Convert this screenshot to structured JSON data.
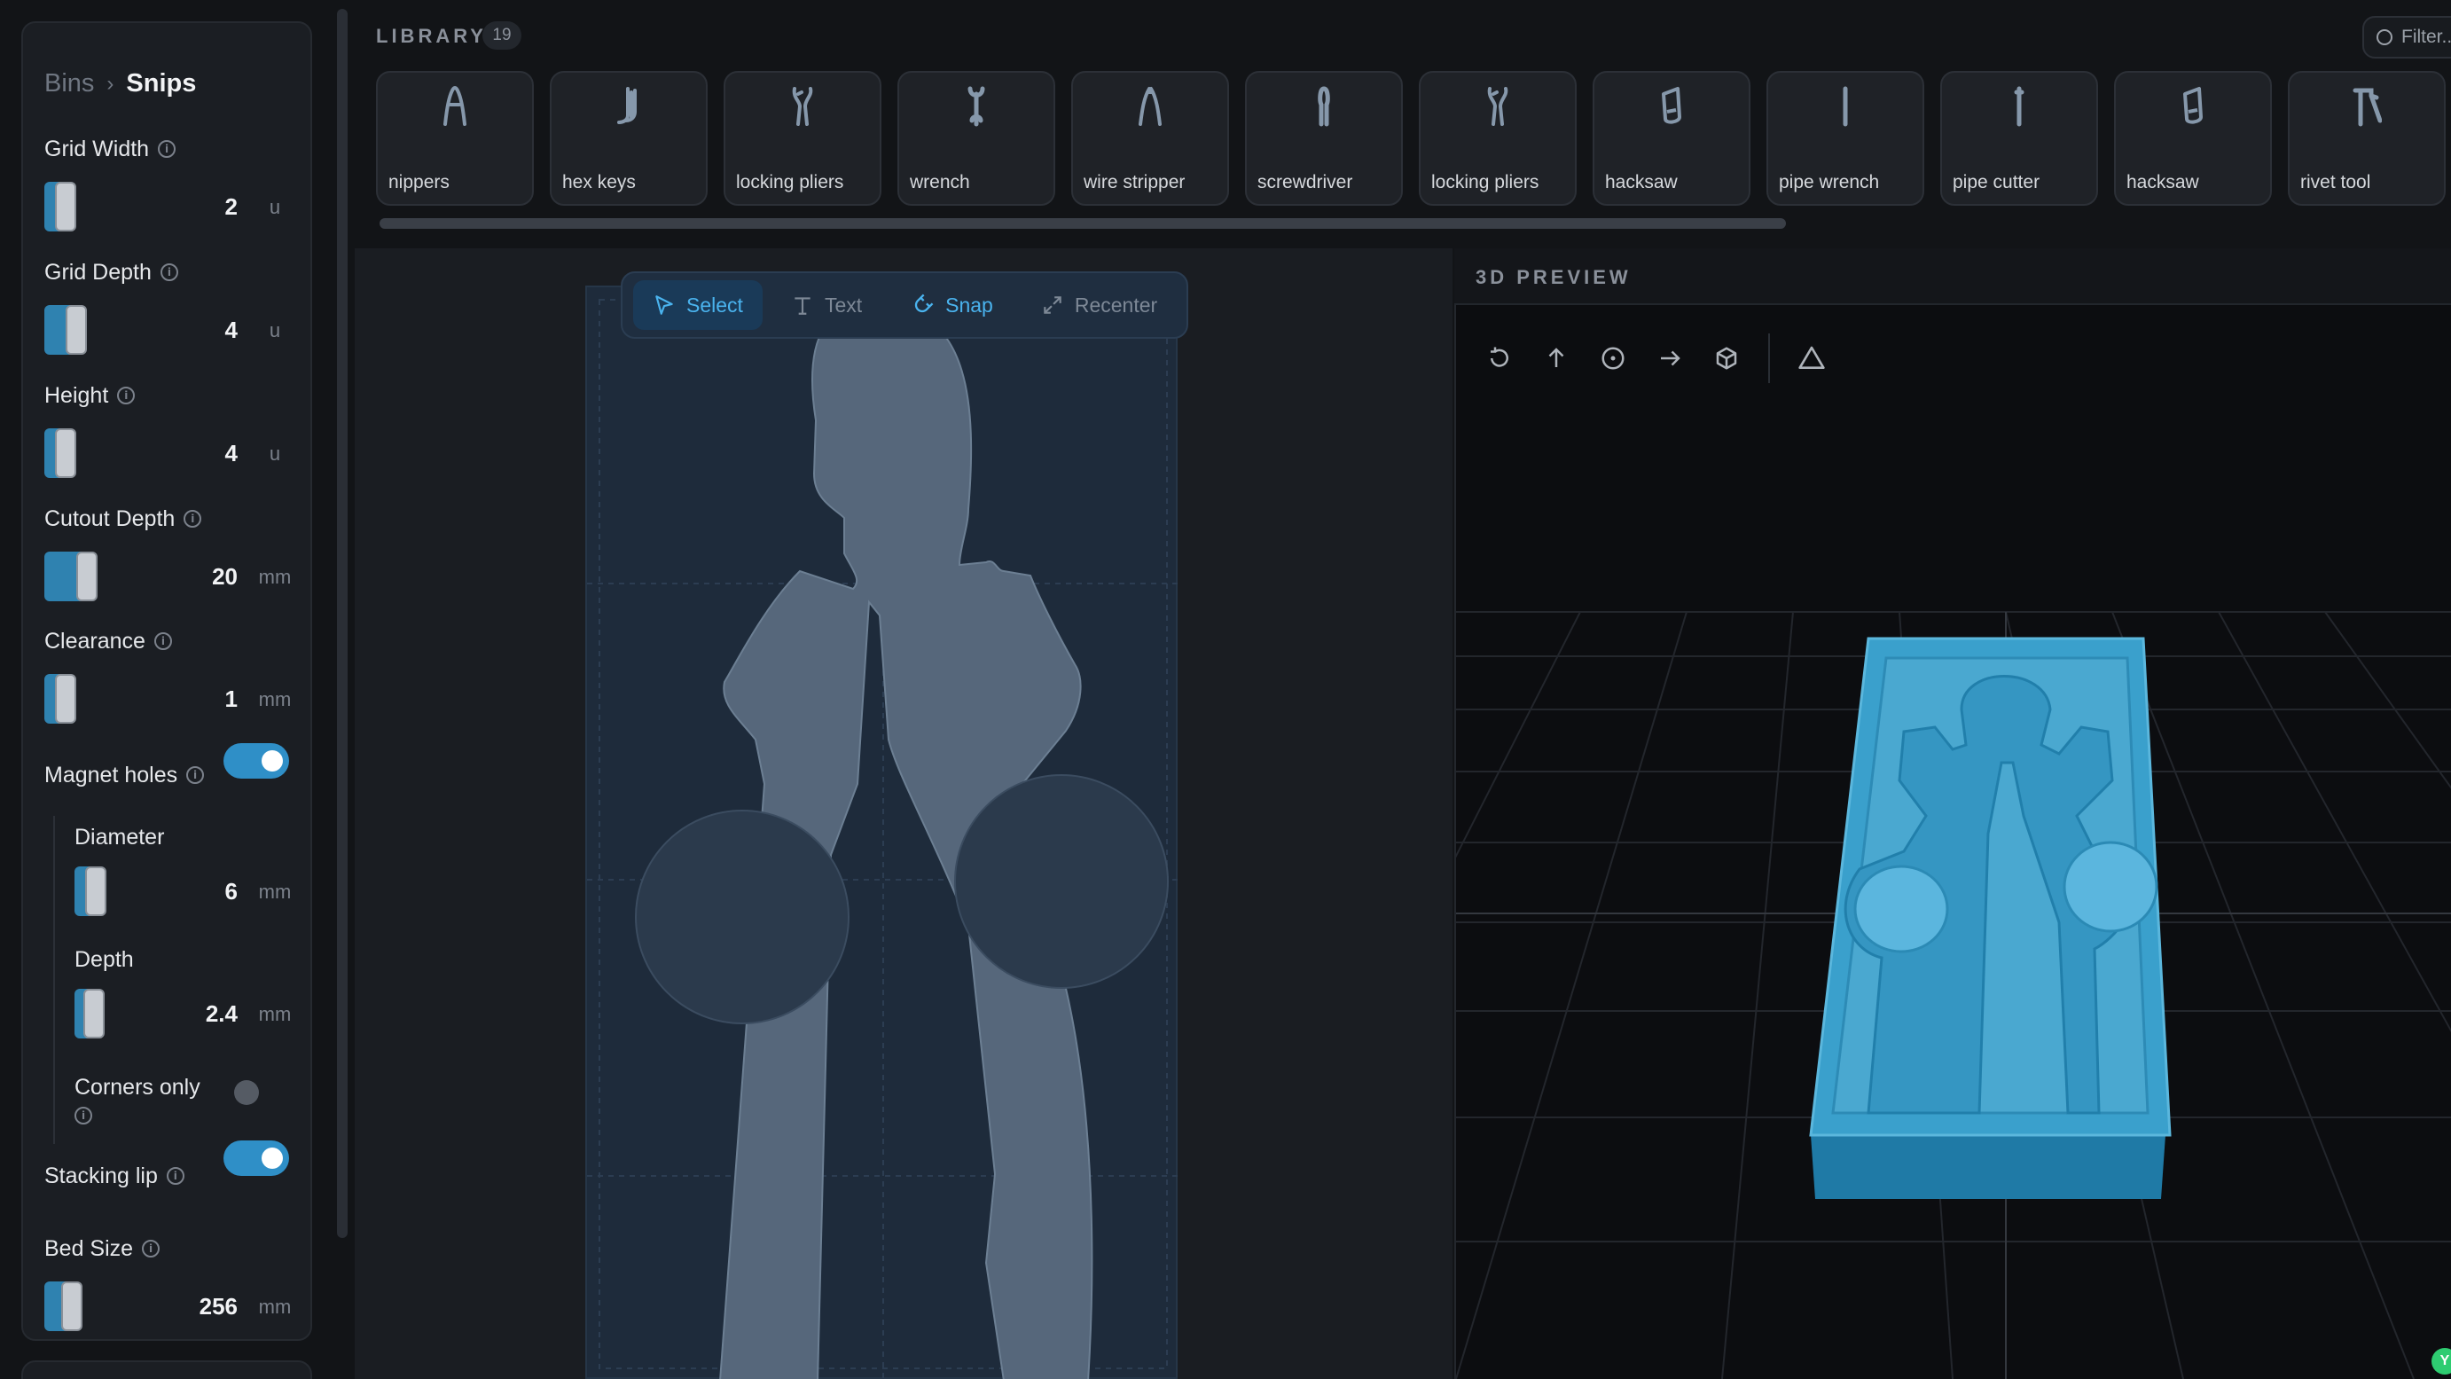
{
  "sidebar": {
    "breadcrumb": {
      "parent": "Bins",
      "current": "Snips"
    },
    "grid_width": {
      "label": "Grid Width",
      "value": "2",
      "unit": "u",
      "fill": 0.05
    },
    "grid_depth": {
      "label": "Grid Depth",
      "value": "4",
      "unit": "u",
      "fill": 0.1
    },
    "height": {
      "label": "Height",
      "value": "4",
      "unit": "u",
      "fill": 0.05
    },
    "cutout_depth": {
      "label": "Cutout Depth",
      "value": "20",
      "unit": "mm",
      "fill": 0.15
    },
    "clearance": {
      "label": "Clearance",
      "value": "1",
      "unit": "mm",
      "fill": 0.05
    },
    "magnet_holes": {
      "label": "Magnet holes",
      "enabled": true
    },
    "diameter": {
      "label": "Diameter",
      "value": "6",
      "unit": "mm",
      "fill": 0.06
    },
    "depth": {
      "label": "Depth",
      "value": "2.4",
      "unit": "mm",
      "fill": 0.05
    },
    "corners_only": {
      "label": "Corners only",
      "enabled": false
    },
    "stacking_lip": {
      "label": "Stacking lip",
      "enabled": true
    },
    "bed_size": {
      "label": "Bed Size",
      "value": "256",
      "unit": "mm",
      "fill": 0.08
    }
  },
  "library": {
    "title": "LIBRARY",
    "count": "19",
    "filter_placeholder": "Filter...",
    "items": [
      {
        "label": "nippers",
        "icon": "nippers-icon"
      },
      {
        "label": "hex keys",
        "icon": "hex-keys-icon"
      },
      {
        "label": "locking pliers",
        "icon": "locking-pliers-icon"
      },
      {
        "label": "wrench",
        "icon": "wrench-icon"
      },
      {
        "label": "wire stripper",
        "icon": "wire-stripper-icon"
      },
      {
        "label": "screwdriver",
        "icon": "screwdriver-icon"
      },
      {
        "label": "locking pliers",
        "icon": "locking-pliers-icon"
      },
      {
        "label": "hacksaw",
        "icon": "hacksaw-icon"
      },
      {
        "label": "pipe wrench",
        "icon": "pipe-wrench-icon"
      },
      {
        "label": "pipe cutter",
        "icon": "pipe-cutter-icon"
      },
      {
        "label": "hacksaw",
        "icon": "hacksaw-icon"
      },
      {
        "label": "rivet tool",
        "icon": "rivet-tool-icon"
      }
    ]
  },
  "canvas_toolbar": {
    "select": "Select",
    "text": "Text",
    "snap": "Snap",
    "recenter": "Recenter"
  },
  "preview": {
    "title": "3D PREVIEW",
    "tools": [
      "reset-view-icon",
      "top-view-icon",
      "center-view-icon",
      "side-view-icon",
      "iso-view-icon",
      "warning-icon"
    ]
  },
  "corner_badge": "Y",
  "colors": {
    "accent": "#2f8fc7",
    "model": "#3aa0cc",
    "bed": "#1e2b3b",
    "tool_outline": "#6c7f93"
  }
}
